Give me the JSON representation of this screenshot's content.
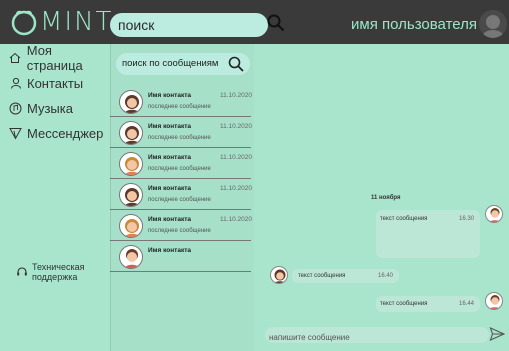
{
  "header": {
    "logo_text": "MINT",
    "search_value": "поиск",
    "username": "имя пользователя"
  },
  "sidebar": {
    "items": [
      {
        "label": "Моя страница",
        "icon": "home-icon"
      },
      {
        "label": "Контакты",
        "icon": "person-icon"
      },
      {
        "label": "Музыка",
        "icon": "music-icon"
      },
      {
        "label": "Мессенджер",
        "icon": "messenger-icon"
      }
    ],
    "support_label_line1": "Техническая",
    "support_label_line2": "поддержка"
  },
  "contacts": {
    "search_placeholder": "поиск по сообщениям",
    "rows": [
      {
        "name": "Имя контакта",
        "date": "11.10.2020",
        "last": "последнее сообщение"
      },
      {
        "name": "Имя контакта",
        "date": "11.10.2020",
        "last": "последнее сообщение"
      },
      {
        "name": "Имя контакта",
        "date": "11.10.2020",
        "last": "последнее сообщение"
      },
      {
        "name": "Имя контакта",
        "date": "11.10.2020",
        "last": "последнее сообщение"
      },
      {
        "name": "Имя контакта",
        "date": "11.10.2020",
        "last": "последнее сообщение"
      },
      {
        "name": "Имя контакта",
        "date": "",
        "last": ""
      }
    ]
  },
  "chat": {
    "date_heading": "11 ноября",
    "messages": [
      {
        "text": "текст сообщения",
        "time": "16.30",
        "side": "right"
      },
      {
        "text": "текст сообщения",
        "time": "16.40",
        "side": "left"
      },
      {
        "text": "текст сообщения",
        "time": "16.44",
        "side": "right"
      }
    ],
    "compose_placeholder": "напишите сообщение"
  },
  "colors": {
    "header_bg": "#3a3a3a",
    "accent_mint": "#9ce6c8",
    "panel_bg": "#a9e4cc"
  }
}
